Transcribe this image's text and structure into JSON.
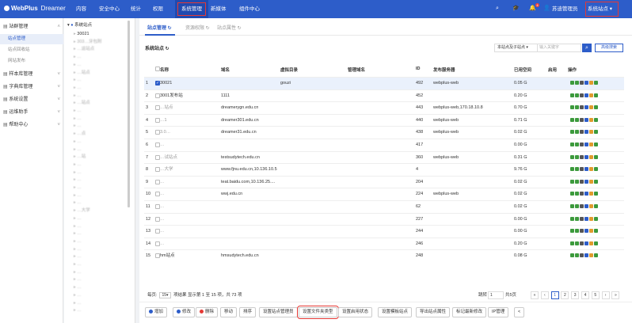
{
  "header": {
    "logo_brand": "WebPlus",
    "logo_sub": "Dreamer",
    "nav": [
      "内容",
      "安全中心",
      "统计",
      "权限",
      "系统管理",
      "新媒体",
      "组件中心"
    ],
    "active_nav": "系统管理",
    "notification_count": "4",
    "user_name": "苏迪管理员",
    "site_switch": "系统站点"
  },
  "sidebar": {
    "groups": [
      {
        "label": "站群管理",
        "expanded": true,
        "items": [
          "站点管理",
          "站点回收站",
          "网站发布"
        ]
      },
      {
        "label": "样本库管理",
        "expanded": false,
        "items": []
      },
      {
        "label": "字典库管理",
        "expanded": false,
        "items": []
      },
      {
        "label": "系统设置",
        "expanded": false,
        "items": []
      },
      {
        "label": "运维助手",
        "expanded": false,
        "items": []
      },
      {
        "label": "帮助中心",
        "expanded": false,
        "items": []
      }
    ]
  },
  "tree": {
    "root": "系统站点",
    "nodes": [
      "30021",
      "303…牙包附",
      "…运站点",
      "…",
      "…",
      "…站点",
      "…",
      "…",
      "…",
      "…站点",
      "…",
      "…",
      "…",
      "…点",
      "…",
      "…",
      "…站",
      "…",
      "…",
      "…",
      "…",
      "…",
      "…",
      "…大学",
      "…",
      "…",
      "…",
      "…",
      "…",
      "…",
      "…",
      "…",
      "…",
      "…",
      "…",
      "…",
      "…"
    ]
  },
  "tabs": [
    "站点管理",
    "资源权限",
    "站点属性"
  ],
  "section_title": "系统站点",
  "search": {
    "scope": "本站点及子站点",
    "placeholder": "输入关键字",
    "advanced": "高级搜索"
  },
  "table": {
    "columns": [
      "名称",
      "域名",
      "虚拟目录",
      "管理域名",
      "ID",
      "发布服务器",
      "已用空间",
      "启用",
      "操作"
    ],
    "rows": [
      {
        "no": "1",
        "name": "30021",
        "domain": "",
        "vdir": "gouzi",
        "mdomain": "",
        "id": "492",
        "server": "webplus-web",
        "space": "0.05 G",
        "checked": true
      },
      {
        "no": "2",
        "name": "3001发布站",
        "domain": "1111",
        "vdir": "",
        "mdomain": "",
        "id": "452",
        "server": "",
        "space": "0.20 G",
        "checked": false
      },
      {
        "no": "3",
        "name": "…站点",
        "domain": "dreamerygn.edu.cn",
        "vdir": "",
        "mdomain": "",
        "id": "443",
        "server": "webplus-web,170.18.10.8",
        "space": "0.70 G",
        "checked": false
      },
      {
        "no": "4",
        "name": "…1",
        "domain": "dreamer301.edu.cn",
        "vdir": "",
        "mdomain": "",
        "id": "440",
        "server": "webplus-web",
        "space": "0.71 G",
        "checked": false
      },
      {
        "no": "5",
        "name": "3.0…",
        "domain": "dreamer31.edu.cn",
        "vdir": "",
        "mdomain": "",
        "id": "438",
        "server": "webplus-web",
        "space": "0.02 G",
        "checked": false
      },
      {
        "no": "6",
        "name": "…",
        "domain": "",
        "vdir": "",
        "mdomain": "",
        "id": "417",
        "server": "",
        "space": "0.00 G",
        "checked": false
      },
      {
        "no": "7",
        "name": "…试站点",
        "domain": "testsudytech.edu.cn",
        "vdir": "",
        "mdomain": "",
        "id": "360",
        "server": "webplus-web",
        "space": "0.31 G",
        "checked": false
      },
      {
        "no": "8",
        "name": "…大学",
        "domain": "www.fjnu.edu.cn,10.136.10.5",
        "vdir": "",
        "mdomain": "",
        "id": "4",
        "server": "",
        "space": "9.76 G",
        "checked": false
      },
      {
        "no": "9",
        "name": "…",
        "domain": "teat.baidu.com,10.136.25....",
        "vdir": "",
        "mdomain": "",
        "id": "204",
        "server": "",
        "space": "0.02 G",
        "checked": false
      },
      {
        "no": "10",
        "name": "…",
        "domain": "wwj.edu.cn",
        "vdir": "",
        "mdomain": "",
        "id": "224",
        "server": "webplus-web",
        "space": "0.02 G",
        "checked": false
      },
      {
        "no": "11",
        "name": "…",
        "domain": "",
        "vdir": "",
        "mdomain": "",
        "id": "62",
        "server": "",
        "space": "0.02 G",
        "checked": false
      },
      {
        "no": "12",
        "name": "…",
        "domain": "",
        "vdir": "",
        "mdomain": "",
        "id": "227",
        "server": "",
        "space": "0.00 G",
        "checked": false
      },
      {
        "no": "13",
        "name": "…",
        "domain": "",
        "vdir": "",
        "mdomain": "",
        "id": "244",
        "server": "",
        "space": "0.00 G",
        "checked": false
      },
      {
        "no": "14",
        "name": "…",
        "domain": "",
        "vdir": "",
        "mdomain": "",
        "id": "246",
        "server": "",
        "space": "0.20 G",
        "checked": false
      },
      {
        "no": "15",
        "name": "hm站点",
        "domain": "hmsudytech.edu.cn",
        "vdir": "",
        "mdomain": "",
        "id": "248",
        "server": "",
        "space": "0.08 G",
        "checked": false
      }
    ]
  },
  "pager": {
    "page_size_label": "每页:",
    "page_size": "15",
    "summary": "项结果 显示第 1 至 15 项，共 73 项",
    "jump_label": "跳转",
    "jump_value": "1",
    "total_pages": "共5页",
    "pages": [
      "1",
      "2",
      "3",
      "4",
      "5"
    ],
    "first": "«",
    "prev": "‹",
    "next": "›",
    "last": "»"
  },
  "actions": [
    "增加",
    "修改",
    "删除",
    "移动",
    "排序",
    "设置站点管理员",
    "设置文件夹类型",
    "设置启用状态",
    "设置模板站点",
    "导出站点属性",
    "标记最新修改",
    "IP管理",
    "<"
  ],
  "highlighted_action": "设置文件夹类型",
  "colors": {
    "primary": "#2d5dc9",
    "highlight": "#e53935"
  }
}
